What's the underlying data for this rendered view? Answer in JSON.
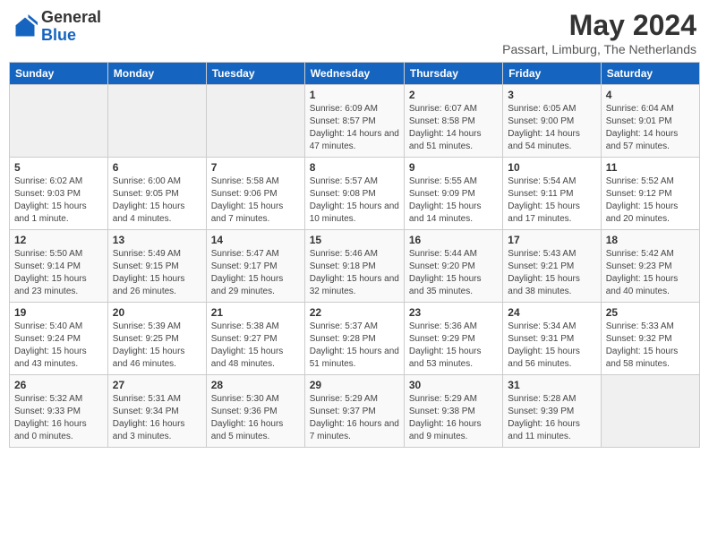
{
  "logo": {
    "general": "General",
    "blue": "Blue"
  },
  "header": {
    "month": "May 2024",
    "location": "Passart, Limburg, The Netherlands"
  },
  "days": [
    "Sunday",
    "Monday",
    "Tuesday",
    "Wednesday",
    "Thursday",
    "Friday",
    "Saturday"
  ],
  "weeks": [
    [
      {
        "day": "",
        "info": ""
      },
      {
        "day": "",
        "info": ""
      },
      {
        "day": "",
        "info": ""
      },
      {
        "day": "1",
        "info": "Sunrise: 6:09 AM\nSunset: 8:57 PM\nDaylight: 14 hours and 47 minutes."
      },
      {
        "day": "2",
        "info": "Sunrise: 6:07 AM\nSunset: 8:58 PM\nDaylight: 14 hours and 51 minutes."
      },
      {
        "day": "3",
        "info": "Sunrise: 6:05 AM\nSunset: 9:00 PM\nDaylight: 14 hours and 54 minutes."
      },
      {
        "day": "4",
        "info": "Sunrise: 6:04 AM\nSunset: 9:01 PM\nDaylight: 14 hours and 57 minutes."
      }
    ],
    [
      {
        "day": "5",
        "info": "Sunrise: 6:02 AM\nSunset: 9:03 PM\nDaylight: 15 hours and 1 minute."
      },
      {
        "day": "6",
        "info": "Sunrise: 6:00 AM\nSunset: 9:05 PM\nDaylight: 15 hours and 4 minutes."
      },
      {
        "day": "7",
        "info": "Sunrise: 5:58 AM\nSunset: 9:06 PM\nDaylight: 15 hours and 7 minutes."
      },
      {
        "day": "8",
        "info": "Sunrise: 5:57 AM\nSunset: 9:08 PM\nDaylight: 15 hours and 10 minutes."
      },
      {
        "day": "9",
        "info": "Sunrise: 5:55 AM\nSunset: 9:09 PM\nDaylight: 15 hours and 14 minutes."
      },
      {
        "day": "10",
        "info": "Sunrise: 5:54 AM\nSunset: 9:11 PM\nDaylight: 15 hours and 17 minutes."
      },
      {
        "day": "11",
        "info": "Sunrise: 5:52 AM\nSunset: 9:12 PM\nDaylight: 15 hours and 20 minutes."
      }
    ],
    [
      {
        "day": "12",
        "info": "Sunrise: 5:50 AM\nSunset: 9:14 PM\nDaylight: 15 hours and 23 minutes."
      },
      {
        "day": "13",
        "info": "Sunrise: 5:49 AM\nSunset: 9:15 PM\nDaylight: 15 hours and 26 minutes."
      },
      {
        "day": "14",
        "info": "Sunrise: 5:47 AM\nSunset: 9:17 PM\nDaylight: 15 hours and 29 minutes."
      },
      {
        "day": "15",
        "info": "Sunrise: 5:46 AM\nSunset: 9:18 PM\nDaylight: 15 hours and 32 minutes."
      },
      {
        "day": "16",
        "info": "Sunrise: 5:44 AM\nSunset: 9:20 PM\nDaylight: 15 hours and 35 minutes."
      },
      {
        "day": "17",
        "info": "Sunrise: 5:43 AM\nSunset: 9:21 PM\nDaylight: 15 hours and 38 minutes."
      },
      {
        "day": "18",
        "info": "Sunrise: 5:42 AM\nSunset: 9:23 PM\nDaylight: 15 hours and 40 minutes."
      }
    ],
    [
      {
        "day": "19",
        "info": "Sunrise: 5:40 AM\nSunset: 9:24 PM\nDaylight: 15 hours and 43 minutes."
      },
      {
        "day": "20",
        "info": "Sunrise: 5:39 AM\nSunset: 9:25 PM\nDaylight: 15 hours and 46 minutes."
      },
      {
        "day": "21",
        "info": "Sunrise: 5:38 AM\nSunset: 9:27 PM\nDaylight: 15 hours and 48 minutes."
      },
      {
        "day": "22",
        "info": "Sunrise: 5:37 AM\nSunset: 9:28 PM\nDaylight: 15 hours and 51 minutes."
      },
      {
        "day": "23",
        "info": "Sunrise: 5:36 AM\nSunset: 9:29 PM\nDaylight: 15 hours and 53 minutes."
      },
      {
        "day": "24",
        "info": "Sunrise: 5:34 AM\nSunset: 9:31 PM\nDaylight: 15 hours and 56 minutes."
      },
      {
        "day": "25",
        "info": "Sunrise: 5:33 AM\nSunset: 9:32 PM\nDaylight: 15 hours and 58 minutes."
      }
    ],
    [
      {
        "day": "26",
        "info": "Sunrise: 5:32 AM\nSunset: 9:33 PM\nDaylight: 16 hours and 0 minutes."
      },
      {
        "day": "27",
        "info": "Sunrise: 5:31 AM\nSunset: 9:34 PM\nDaylight: 16 hours and 3 minutes."
      },
      {
        "day": "28",
        "info": "Sunrise: 5:30 AM\nSunset: 9:36 PM\nDaylight: 16 hours and 5 minutes."
      },
      {
        "day": "29",
        "info": "Sunrise: 5:29 AM\nSunset: 9:37 PM\nDaylight: 16 hours and 7 minutes."
      },
      {
        "day": "30",
        "info": "Sunrise: 5:29 AM\nSunset: 9:38 PM\nDaylight: 16 hours and 9 minutes."
      },
      {
        "day": "31",
        "info": "Sunrise: 5:28 AM\nSunset: 9:39 PM\nDaylight: 16 hours and 11 minutes."
      },
      {
        "day": "",
        "info": ""
      }
    ]
  ]
}
